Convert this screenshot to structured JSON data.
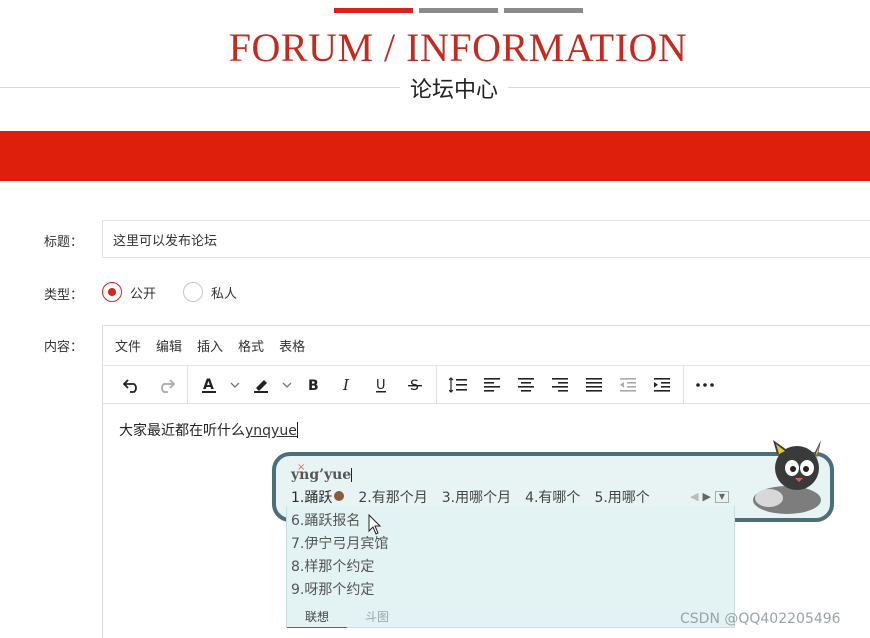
{
  "header": {
    "title_en": "FORUM / INFORMATION",
    "title_cn": "论坛中心"
  },
  "form": {
    "title_label": "标题：",
    "title_value": "这里可以发布论坛",
    "type_label": "类型：",
    "type_options": [
      "公开",
      "私人"
    ],
    "type_selected": "公开",
    "content_label": "内容："
  },
  "editor": {
    "menu": [
      "文件",
      "编辑",
      "插入",
      "格式",
      "表格"
    ],
    "content_text": "大家最近都在听什么",
    "typing_text": "ynqyue"
  },
  "ime": {
    "pinyin": "yng’yue",
    "candidates_row": [
      "1.踊跃",
      "2.有那个月",
      "3.用哪个月",
      "4.有哪个",
      "5.用哪个"
    ],
    "candidates_more": [
      "6.踊跃报名",
      "7.伊宁弓月宾馆",
      "8.样那个约定",
      "9.呀那个约定"
    ],
    "tabs": [
      "联想",
      "斗图"
    ]
  },
  "watermark": "CSDN @QQ402205496",
  "colors": {
    "accent_red": "#dd1f0b",
    "title_red": "#c62a1f",
    "ime_border": "#4b6f77"
  }
}
